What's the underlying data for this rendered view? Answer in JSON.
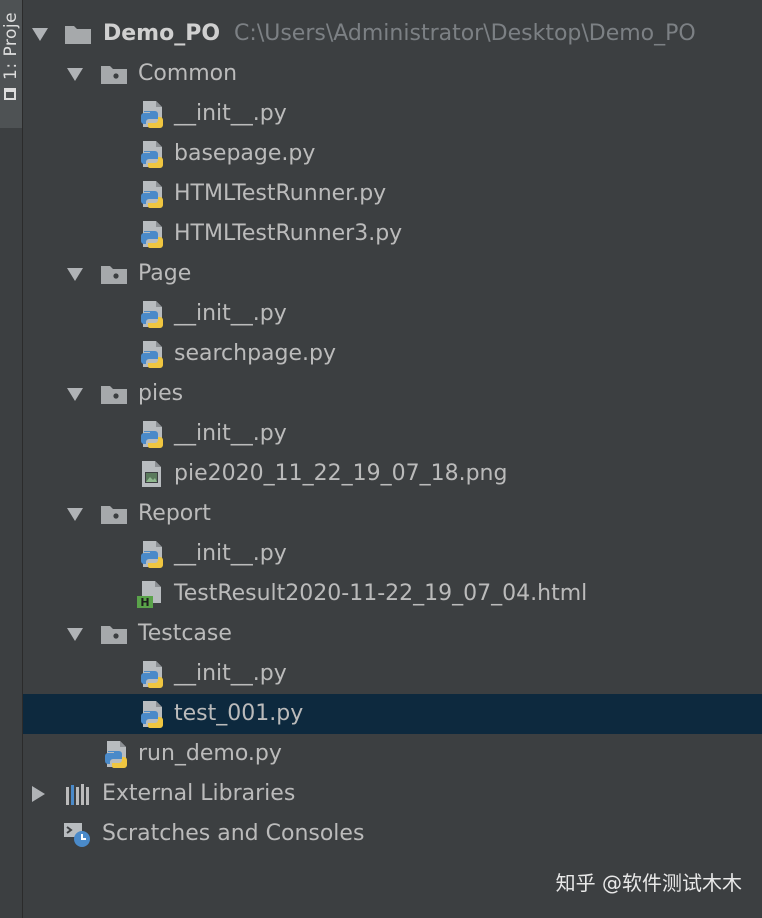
{
  "sidebar": {
    "tab_label": "1: Proje"
  },
  "tree": {
    "root": {
      "name": "Demo_PO",
      "path": "C:\\Users\\Administrator\\Desktop\\Demo_PO"
    },
    "common": {
      "name": "Common",
      "files": [
        "__init__.py",
        "basepage.py",
        "HTMLTestRunner.py",
        "HTMLTestRunner3.py"
      ]
    },
    "page": {
      "name": "Page",
      "files": [
        "__init__.py",
        "searchpage.py"
      ]
    },
    "pies": {
      "name": "pies",
      "files": [
        "__init__.py",
        "pie2020_11_22_19_07_18.png"
      ]
    },
    "report": {
      "name": "Report",
      "files": [
        "__init__.py",
        "TestResult2020-11-22_19_07_04.html"
      ]
    },
    "testcase": {
      "name": "Testcase",
      "files": [
        "__init__.py",
        "test_001.py"
      ]
    },
    "run_demo": "run_demo.py",
    "external_libraries": "External Libraries",
    "scratches": "Scratches and Consoles"
  },
  "selected_item": "test_001.py",
  "watermark": "知乎 @软件测试木木",
  "colors": {
    "background": "#3c3f41",
    "selection": "#0d293e",
    "text": "#bbbbbb",
    "path_text": "#7c8084",
    "folder": "#a6a9ab",
    "python_blue": "#4a8ac9",
    "python_yellow": "#f0c640",
    "html_green": "#5aa34a"
  },
  "icons": {
    "folder": "folder-icon",
    "python_file": "python-file-icon",
    "image_file": "image-file-icon",
    "html_file": "html-file-icon",
    "libraries": "libraries-icon",
    "scratches": "scratches-icon"
  }
}
